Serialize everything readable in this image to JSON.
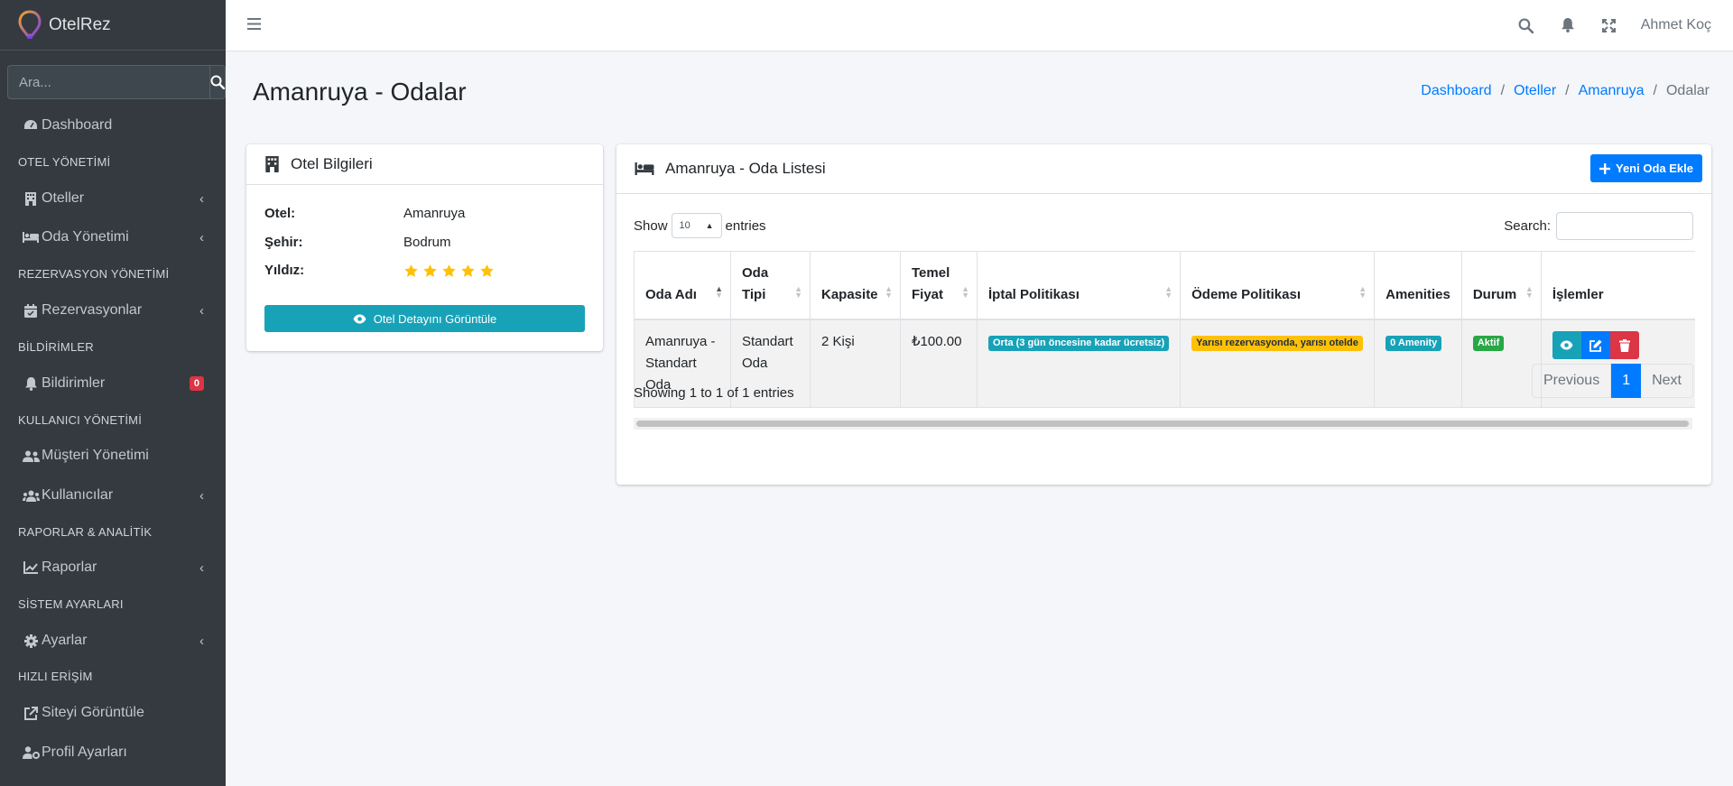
{
  "app": {
    "brand": "OtelRez"
  },
  "sidebar": {
    "search_placeholder": "Ara...",
    "items": {
      "dashboard": "Dashboard",
      "header_otel": "OTEL YÖNETİMİ",
      "oteller": "Oteller",
      "oda": "Oda Yönetimi",
      "header_rez": "REZERVASYON YÖNETİMİ",
      "rezervasyonlar": "Rezervasyonlar",
      "header_bildirim": "BİLDİRİMLER",
      "bildirimler": "Bildirimler",
      "bildirim_count": "0",
      "header_kullanici": "KULLANICI YÖNETİMİ",
      "musteri": "Müşteri Yönetimi",
      "kullanicilar": "Kullanıcılar",
      "header_rapor": "RAPORLAR & ANALİTİK",
      "raporlar": "Raporlar",
      "header_sistem": "SİSTEM AYARLARI",
      "ayarlar": "Ayarlar",
      "header_hizli": "HIZLI ERİŞİM",
      "siteyi": "Siteyi Görüntüle",
      "profil": "Profil Ayarları"
    }
  },
  "navbar": {
    "user": "Ahmet Koç"
  },
  "page": {
    "title": "Amanruya - Odalar",
    "breadcrumb": [
      "Dashboard",
      "Oteller",
      "Amanruya",
      "Odalar"
    ]
  },
  "hotel_card": {
    "title": "Otel Bilgileri",
    "otel_label": "Otel:",
    "otel_value": "Amanruya",
    "sehir_label": "Şehir:",
    "sehir_value": "Bodrum",
    "yildiz_label": "Yıldız:",
    "stars": 5,
    "button": "Otel Detayını Görüntüle"
  },
  "room_card": {
    "title": "Amanruya - Oda Listesi",
    "add_button": "Yeni Oda Ekle",
    "show_label": "Show",
    "entries_value": "10",
    "entries_label": "entries",
    "search_label": "Search:",
    "columns": [
      "Oda Adı",
      "Oda Tipi",
      "Kapasite",
      "Temel Fiyat",
      "İptal Politikası",
      "Ödeme Politikası",
      "Amenities",
      "Durum",
      "İşlemler"
    ],
    "rows": [
      {
        "oda_adi": "Amanruya - Standart Oda",
        "oda_tipi": "Standart Oda",
        "kapasite": "2 Kişi",
        "fiyat": "₺100.00",
        "iptal": "Orta (3 gün öncesine kadar ücretsiz)",
        "odeme": "Yarısı rezervasyonda, yarısı otelde",
        "amenities": "0 Amenity",
        "durum": "Aktif"
      }
    ],
    "info": "Showing 1 to 1 of 1 entries",
    "pager": {
      "prev": "Previous",
      "current": "1",
      "next": "Next"
    }
  },
  "colors": {
    "sidebar": "#343a40",
    "primary": "#007bff",
    "info": "#17a2b8",
    "danger": "#dc3545",
    "warning": "#ffc107",
    "success": "#28a745",
    "star": "#ffc107"
  }
}
